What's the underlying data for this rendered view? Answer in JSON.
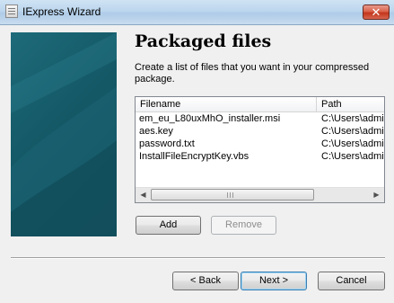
{
  "window": {
    "title": "IExpress Wizard",
    "close_glyph": "✕",
    "icon": "iexpress-app-icon"
  },
  "page": {
    "heading": "Packaged files",
    "instructions": "Create a list of files that you want in your compressed package."
  },
  "file_list": {
    "columns": [
      "Filename",
      "Path"
    ],
    "rows": [
      {
        "filename": "em_eu_L80uxMhO_installer.msi",
        "path": "C:\\Users\\admi"
      },
      {
        "filename": "aes.key",
        "path": "C:\\Users\\admi"
      },
      {
        "filename": "password.txt",
        "path": "C:\\Users\\admi"
      },
      {
        "filename": "InstallFileEncryptKey.vbs",
        "path": "C:\\Users\\admi"
      }
    ],
    "scroll_left_glyph": "◀",
    "scroll_right_glyph": "▶"
  },
  "actions": {
    "add_label": "Add",
    "remove_label": "Remove"
  },
  "nav": {
    "back_label": "< Back",
    "next_label": "Next >",
    "cancel_label": "Cancel"
  },
  "colors": {
    "banner": "#155a68",
    "titlebar": "#bcd6ee",
    "close_button": "#c2361c"
  }
}
